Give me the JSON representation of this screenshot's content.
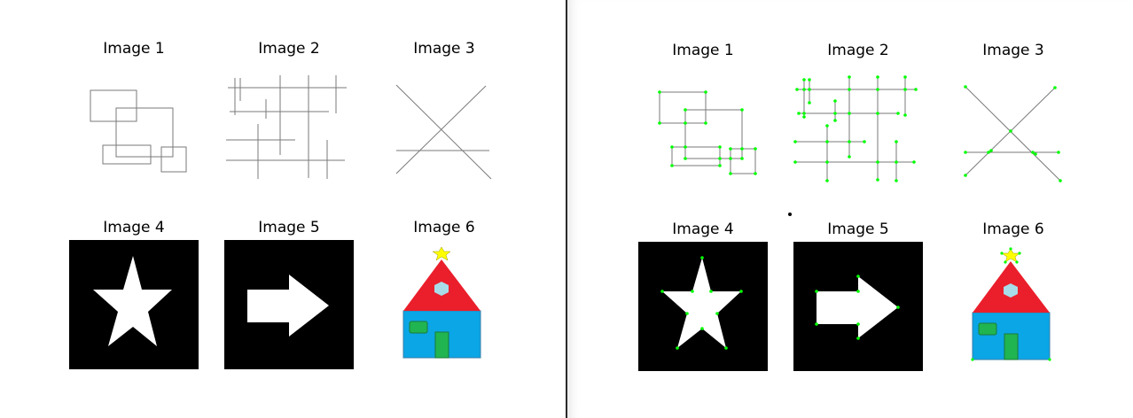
{
  "left": {
    "titles": [
      "Image 1",
      "Image 2",
      "Image 3",
      "Image 4",
      "Image 5",
      "Image 6"
    ]
  },
  "right": {
    "titles": [
      "Image 1",
      "Image 2",
      "Image 3",
      "Image 4",
      "Image 5",
      "Image 6"
    ]
  },
  "colors": {
    "keypoint": "#00ff00",
    "line": "#7a7a7a",
    "panel_bg": "#000000",
    "shape_fill": "#ffffff",
    "roof": "#ea1f2b",
    "wall": "#0aa6e6",
    "door": "#20b550",
    "window": "#20b550",
    "roof_window": "#a8dce8",
    "star": "#ffff00"
  }
}
